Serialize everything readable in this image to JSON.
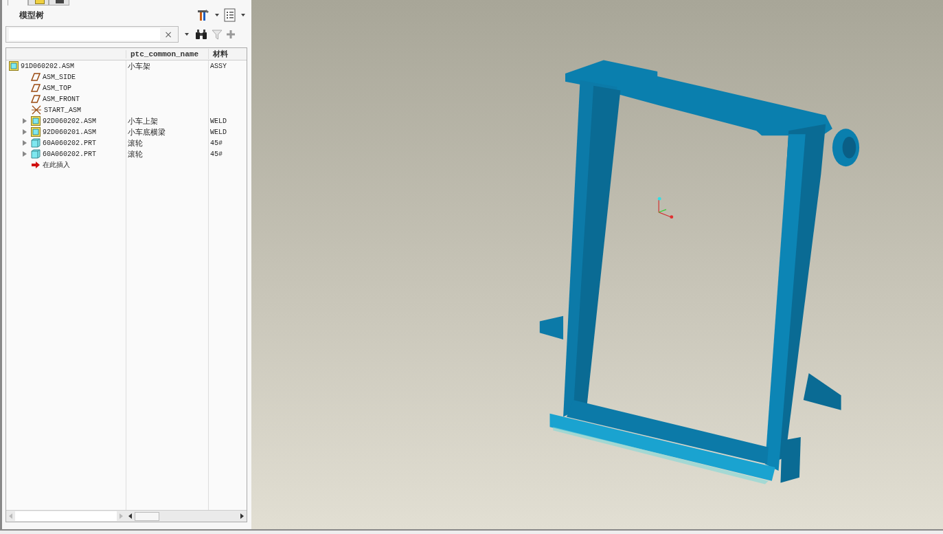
{
  "panel": {
    "title": "模型树",
    "clear_symbol": "×"
  },
  "table": {
    "columns": [
      "ptc_common_name",
      "材料"
    ],
    "tree": [
      {
        "kind": "assembly",
        "name": "91D060202.ASM",
        "common_name": "小车架",
        "material": "ASSY",
        "children": [
          {
            "kind": "datum-plane",
            "name": "ASM_SIDE"
          },
          {
            "kind": "datum-plane",
            "name": "ASM_TOP"
          },
          {
            "kind": "datum-plane",
            "name": "ASM_FRONT"
          },
          {
            "kind": "csys",
            "name": "START_ASM"
          },
          {
            "kind": "assembly",
            "name": "92D060202.ASM",
            "common_name": "小车上架",
            "material": "WELD",
            "collapsed": true
          },
          {
            "kind": "assembly",
            "name": "92D060201.ASM",
            "common_name": "小车底横梁",
            "material": "WELD",
            "collapsed": true
          },
          {
            "kind": "part",
            "name": "60A060202.PRT",
            "common_name": "滚轮",
            "material": "45#",
            "collapsed": true
          },
          {
            "kind": "part",
            "name": "60A060202.PRT",
            "common_name": "滚轮",
            "material": "45#",
            "collapsed": true
          },
          {
            "kind": "insert",
            "name": "在此插入"
          }
        ]
      }
    ]
  }
}
